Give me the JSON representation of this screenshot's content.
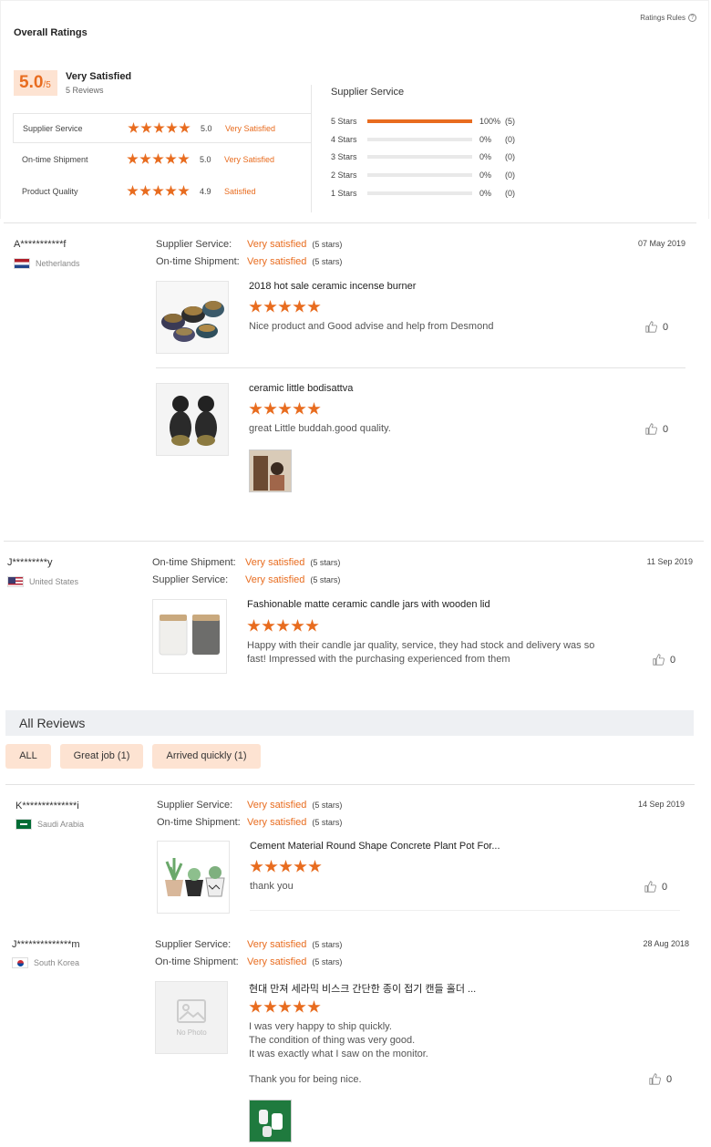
{
  "overall": {
    "title": "Overall Ratings",
    "rules_label": "Ratings Rules",
    "score": "5.0",
    "score_max": "/5",
    "summary": "Very Satisfied",
    "review_count": "5 Reviews",
    "metrics": [
      {
        "label": "Supplier Service",
        "value": "5.0",
        "status": "Very Satisfied",
        "stars": 5
      },
      {
        "label": "On-time Shipment",
        "value": "5.0",
        "status": "Very Satisfied",
        "stars": 5
      },
      {
        "label": "Product Quality",
        "value": "4.9",
        "status": "Satisfied",
        "stars": 5
      }
    ],
    "distribution_title": "Supplier Service",
    "distribution": [
      {
        "label": "5  Stars",
        "fraction": 1.0,
        "pct": "100%",
        "count": "(5)"
      },
      {
        "label": "4  Stars",
        "fraction": 0,
        "pct": "0%",
        "count": "(0)"
      },
      {
        "label": "3  Stars",
        "fraction": 0,
        "pct": "0%",
        "count": "(0)"
      },
      {
        "label": "2  Stars",
        "fraction": 0,
        "pct": "0%",
        "count": "(0)"
      },
      {
        "label": "1  Stars",
        "fraction": 0,
        "pct": "0%",
        "count": "(0)"
      }
    ]
  },
  "colors": {
    "accent": "#e86c1f",
    "badge_bg": "#fde3d2",
    "bar_bg": "#eef0f3"
  },
  "reviews_top": [
    {
      "user": "A***********f",
      "country": "Netherlands",
      "date": "07 May 2019",
      "lines": [
        {
          "key": "Supplier Service:",
          "value": "Very satisfied",
          "note": "(5 stars)"
        },
        {
          "key": "On-time Shipment:",
          "value": "Very satisfied",
          "note": "(5 stars)"
        }
      ],
      "products": [
        {
          "title": "2018 hot sale ceramic incense burner",
          "text": "Nice product and Good advise and help from Desmond",
          "likes": "0",
          "stars": 5
        },
        {
          "title": "ceramic little bodisattva",
          "text": "great Little buddah.good quality.",
          "likes": "0",
          "stars": 5
        }
      ]
    },
    {
      "user": "J*********y",
      "country": "United States",
      "date": "11 Sep 2019",
      "lines": [
        {
          "key": "On-time Shipment:",
          "value": "Very satisfied",
          "note": "(5 stars)"
        },
        {
          "key": "Supplier Service:",
          "value": "Very satisfied",
          "note": "(5 stars)"
        }
      ],
      "products": [
        {
          "title": "Fashionable matte ceramic candle jars with wooden lid",
          "text_l1": "Happy with their candle jar quality, service, they had stock and delivery was so",
          "text_l2": "fast! Impressed with the purchasing experienced from them",
          "likes": "0",
          "stars": 5
        }
      ]
    }
  ],
  "all_reviews": {
    "title": "All Reviews",
    "filters": [
      "ALL",
      "Great job (1)",
      "Arrived quickly (1)"
    ]
  },
  "reviews_all": [
    {
      "user": "K**************i",
      "country": "Saudi Arabia",
      "date": "14 Sep 2019",
      "lines": [
        {
          "key": "Supplier Service:",
          "value": "Very satisfied",
          "note": "(5 stars)"
        },
        {
          "key": "On-time Shipment:",
          "value": "Very satisfied",
          "note": "(5 stars)"
        }
      ],
      "product": {
        "title": "Cement Material Round Shape Concrete Plant Pot For...",
        "text": "thank you",
        "likes": "0",
        "stars": 5
      }
    },
    {
      "user": "J**************m",
      "country": "South Korea",
      "date": "28 Aug 2018",
      "lines": [
        {
          "key": "Supplier Service:",
          "value": "Very satisfied",
          "note": "(5 stars)"
        },
        {
          "key": "On-time Shipment:",
          "value": "Very satisfied",
          "note": "(5 stars)"
        }
      ],
      "product": {
        "title": "현대 만져 세라믹 비스크 간단한 종이 접기 캔들 홀더 ...",
        "text_l1": "I was very happy to ship quickly.",
        "text_l2": "The condition of thing was very good.",
        "text_l3": "It was exactly what I saw on the monitor.",
        "text_l4": "Thank you for being nice.",
        "no_photo": "No Photo",
        "likes": "0",
        "stars": 5
      }
    }
  ]
}
